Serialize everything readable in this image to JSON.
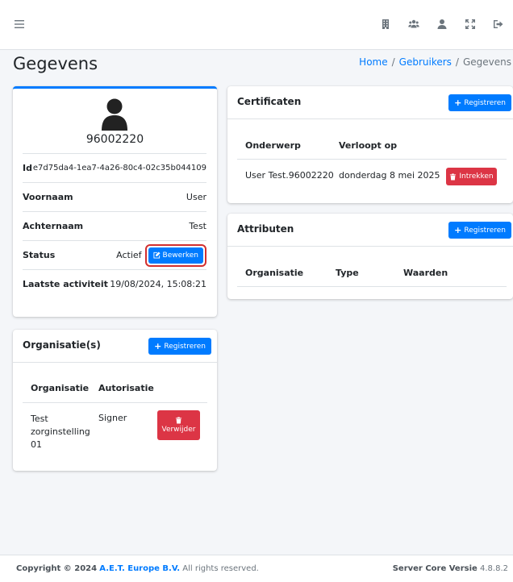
{
  "header": {
    "menu_icon": "hamburger-icon",
    "icons": [
      "building-icon",
      "users-icon",
      "user-icon",
      "expand-icon",
      "logout-icon"
    ]
  },
  "page": {
    "title": "Gegevens",
    "breadcrumb": [
      "Home",
      "Gebruikers",
      "Gegevens"
    ],
    "breadcrumb_sep": "/"
  },
  "profile": {
    "username": "96002220",
    "rows": {
      "id": {
        "label": "Id",
        "value": "e7d75da4-1ea7-4a26-80c4-02c35b044109"
      },
      "first_name": {
        "label": "Voornaam",
        "value": "User"
      },
      "last_name": {
        "label": "Achternaam",
        "value": "Test"
      },
      "status": {
        "label": "Status",
        "value": "Actief"
      },
      "last_activity": {
        "label": "Laatste activiteit",
        "value": "19/08/2024, 15:08:21"
      }
    },
    "edit_label": "Bewerken"
  },
  "organisations": {
    "title": "Organisatie(s)",
    "register_label": "Registreren",
    "columns": [
      "Organisatie",
      "Autorisatie"
    ],
    "rows": [
      {
        "org_lines": [
          "Test",
          "zorginstelling",
          "01"
        ],
        "authorisation": "Signer",
        "action": "Verwijder"
      }
    ]
  },
  "certificates": {
    "title": "Certificaten",
    "register_label": "Registreren",
    "columns": [
      "Onderwerp",
      "Verloopt op"
    ],
    "rows": [
      {
        "subject": "User Test.96002220",
        "expires": "donderdag 8 mei 2025",
        "action": "Intrekken"
      }
    ]
  },
  "attributes": {
    "title": "Attributen",
    "register_label": "Registreren",
    "columns": [
      "Organisatie",
      "Type",
      "Waarden"
    ]
  },
  "footer": {
    "copyright": "Copyright © 2024",
    "brand": "A.E.T. Europe B.V.",
    "rights": "All rights reserved.",
    "version_label": "Server Core Versie",
    "version": "4.8.8.2"
  },
  "colors": {
    "primary": "#007bff",
    "danger": "#dc3545",
    "highlight": "#d32f2f"
  }
}
